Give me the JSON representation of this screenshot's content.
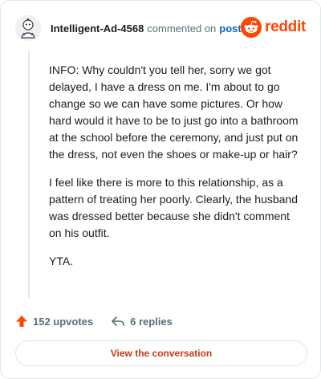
{
  "header": {
    "username": "Intelligent-Ad-4568",
    "action_text": "commented on",
    "post_link": "post",
    "logo_text": "reddit"
  },
  "comment": {
    "paragraphs": [
      "INFO: Why couldn't you tell her, sorry we got delayed, I have a dress on me. I'm about to go change so we can have some pictures. Or how hard would it have to be to just go into a bathroom at the school before the ceremony, and just put on the dress, not even the shoes or make-up or hair?",
      "I feel like there is more to this relationship, as a pattern of treating her poorly. Clearly, the husband was dressed better because she didn't comment on his outfit.",
      "YTA."
    ]
  },
  "footer": {
    "upvotes": "152 upvotes",
    "replies": "6 replies"
  },
  "cta": {
    "label": "View the conversation"
  },
  "colors": {
    "brand": "#ff4500",
    "link": "#0a66c2",
    "cta_text": "#c4381b",
    "muted": "#576f76"
  }
}
